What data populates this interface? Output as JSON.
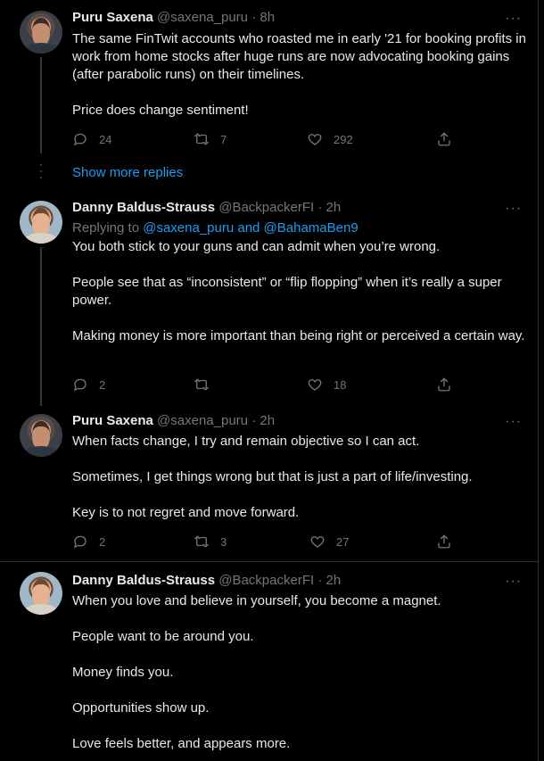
{
  "tweets": [
    {
      "name": "Puru Saxena",
      "handle": "@saxena_puru",
      "time": "8h",
      "text": [
        "The same FinTwit accounts who roasted me in early '21 for booking profits in work from home stocks after huge runs are now advocating booking gains (after parabolic runs) on their timelines.",
        "Price does change sentiment!"
      ],
      "replies": "24",
      "retweets": "7",
      "likes": "292"
    },
    {
      "name": "Danny Baldus-Strauss",
      "handle": "@BackpackerFI",
      "time": "2h",
      "replying_prefix": "Replying to",
      "replying_to": "@saxena_puru and @BahamaBen9",
      "text": [
        "You both stick to your guns and can admit when you’re wrong.",
        "People see that as “inconsistent” or “flip flopping” when it’s really a super power.",
        "Making money is more important than being right or perceived a certain way."
      ],
      "replies": "2",
      "retweets": "",
      "likes": "18"
    },
    {
      "name": "Puru Saxena",
      "handle": "@saxena_puru",
      "time": "2h",
      "text": [
        "When facts change, I try and remain objective so I can act.",
        "Sometimes, I get things wrong but that is just a part of life/investing.",
        "Key is to not regret and move forward."
      ],
      "replies": "2",
      "retweets": "3",
      "likes": "27"
    },
    {
      "name": "Danny Baldus-Strauss",
      "handle": "@BackpackerFI",
      "time": "2h",
      "text": [
        "When you love and believe in yourself, you become a magnet.",
        "People want to be around you.",
        "Money finds you.",
        "Opportunities show up.",
        "Love feels better, and appears more."
      ]
    }
  ],
  "show_more_replies": "Show more replies",
  "separator": "·",
  "more_glyph": "···"
}
